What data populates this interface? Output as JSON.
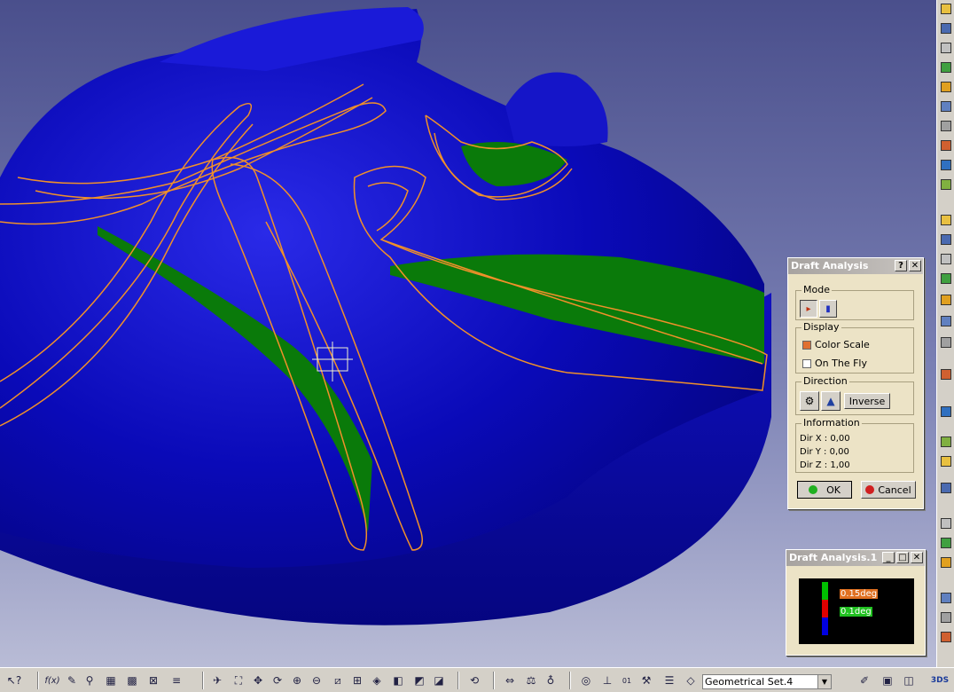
{
  "draft_dialog": {
    "title": "Draft Analysis",
    "help_label": "?",
    "close_label": "✕",
    "mode_label": "Mode",
    "display_label": "Display",
    "color_scale_label": "Color Scale",
    "color_scale_checked": true,
    "on_the_fly_label": "On The Fly",
    "on_the_fly_checked": false,
    "direction_label": "Direction",
    "inverse_label": "Inverse",
    "information_label": "Information",
    "dir_x": "Dir X : 0,00",
    "dir_y": "Dir Y : 0,00",
    "dir_z": "Dir Z : 1,00",
    "ok_label": "OK",
    "cancel_label": "Cancel"
  },
  "result_window": {
    "title": "Draft Analysis.1",
    "upper_value": "0.15deg",
    "lower_value": "0.1deg",
    "colors": {
      "green": "#00c000",
      "red": "#e00000",
      "blue": "#0000e0",
      "upper_bg": "#e07020",
      "lower_bg": "#20c020"
    }
  },
  "bottom_toolbar": {
    "help_icon_label": "↖?",
    "formula_label": "f(x)",
    "geometrical_set": "Geometrical Set.4"
  },
  "colors": {
    "surface": "#0a0aa8",
    "draft_green": "#0a7a0a",
    "wire_orange": "#f0902a"
  }
}
